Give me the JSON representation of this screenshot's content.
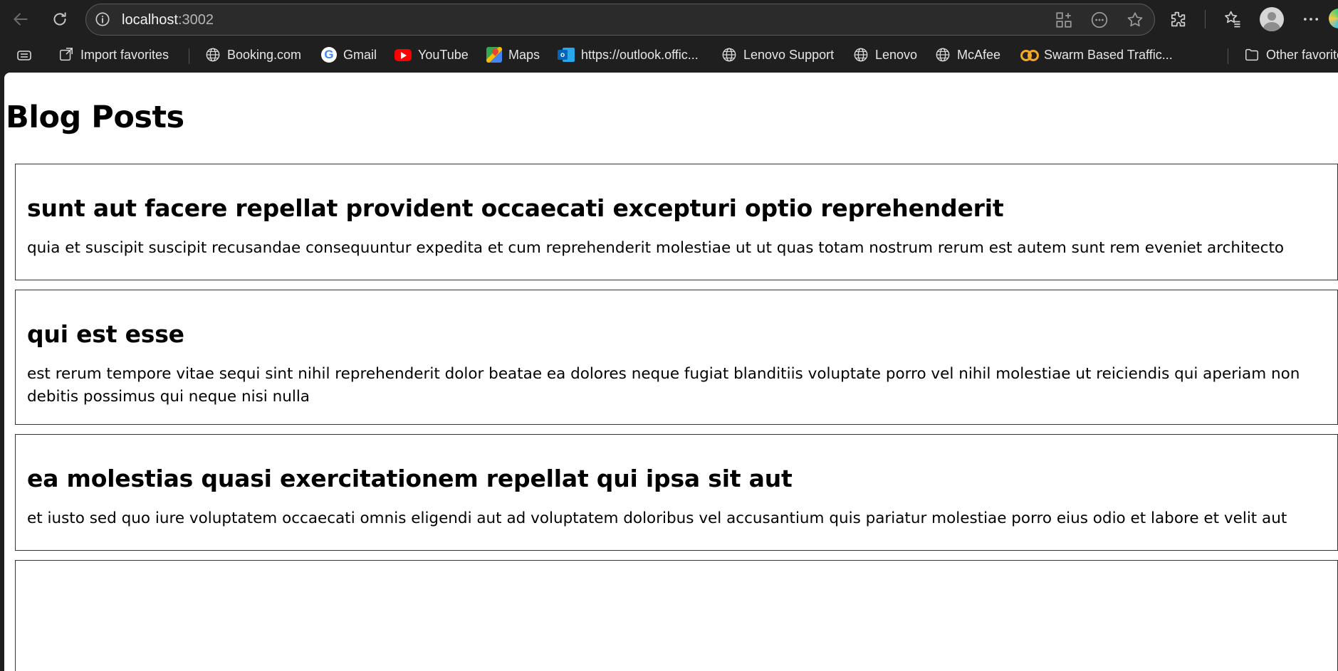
{
  "browser": {
    "url_host": "localhost",
    "url_port": ":3002",
    "bookmarks": [
      {
        "label": "Import favorites",
        "icon": "import-icon"
      },
      {
        "label": "Booking.com",
        "icon": "globe-icon"
      },
      {
        "label": "Gmail",
        "icon": "google-icon"
      },
      {
        "label": "YouTube",
        "icon": "youtube-icon"
      },
      {
        "label": "Maps",
        "icon": "maps-icon"
      },
      {
        "label": "https://outlook.offic...",
        "icon": "outlook-icon"
      },
      {
        "label": "Lenovo Support",
        "icon": "globe-icon"
      },
      {
        "label": "Lenovo",
        "icon": "globe-icon"
      },
      {
        "label": "McAfee",
        "icon": "globe-icon"
      },
      {
        "label": "Swarm Based Traffic...",
        "icon": "swarm-icon"
      },
      {
        "label": "Other favorites",
        "icon": "folder-icon"
      }
    ]
  },
  "page": {
    "heading": "Blog Posts",
    "posts": [
      {
        "title": "sunt aut facere repellat provident occaecati excepturi optio reprehenderit",
        "body": "quia et suscipit suscipit recusandae consequuntur expedita et cum reprehenderit molestiae ut ut quas totam nostrum rerum est autem sunt rem eveniet architecto"
      },
      {
        "title": "qui est esse",
        "body": "est rerum tempore vitae sequi sint nihil reprehenderit dolor beatae ea dolores neque fugiat blanditiis voluptate porro vel nihil molestiae ut reiciendis qui aperiam non debitis possimus qui neque nisi nulla"
      },
      {
        "title": "ea molestias quasi exercitationem repellat qui ipsa sit aut",
        "body": "et iusto sed quo iure voluptatem occaecati omnis eligendi aut ad voluptatem doloribus vel accusantium quis pariatur molestiae porro eius odio et labore et velit aut"
      }
    ]
  }
}
